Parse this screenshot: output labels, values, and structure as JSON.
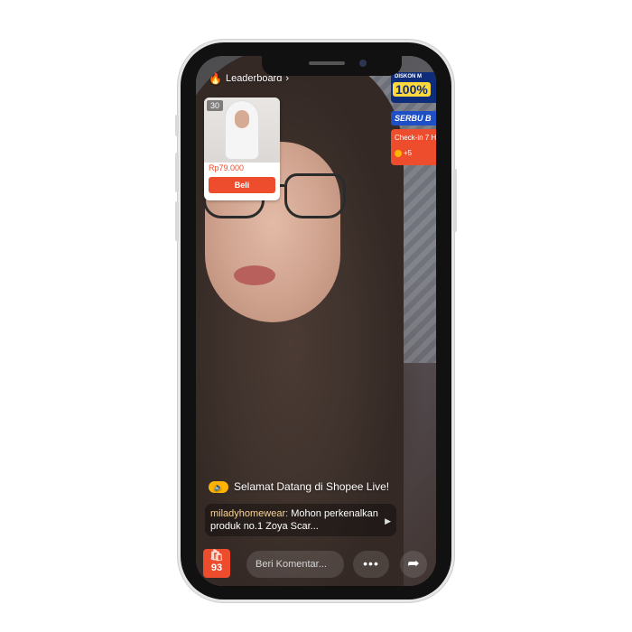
{
  "leaderboard": {
    "label": "Leaderboard",
    "icon": "flame-icon",
    "chevron": "›"
  },
  "product_card": {
    "count": "30",
    "price": "Rp79.000",
    "button_label": "Beli"
  },
  "promo": {
    "banner_1_title": "DISKON M",
    "banner_1_value": "100%",
    "banner_2_label": "SERBU B",
    "checkin_label": "Check-in 7 H",
    "checkin_reward": "+5"
  },
  "welcome": {
    "text": "Selamat Datang di Shopee Live!"
  },
  "comment": {
    "username": "miladyhomewear:",
    "message": " Mohon perkenalkan produk no.1 Zoya Scar..."
  },
  "bottom_bar": {
    "cart_count": "93",
    "comment_placeholder": "Beri Komentar...",
    "more_icon": "•••",
    "share_icon": "➦"
  },
  "colors": {
    "accent": "#ee4d2d",
    "coin": "#ffb400",
    "promo_blue": "#0d2c7a"
  }
}
